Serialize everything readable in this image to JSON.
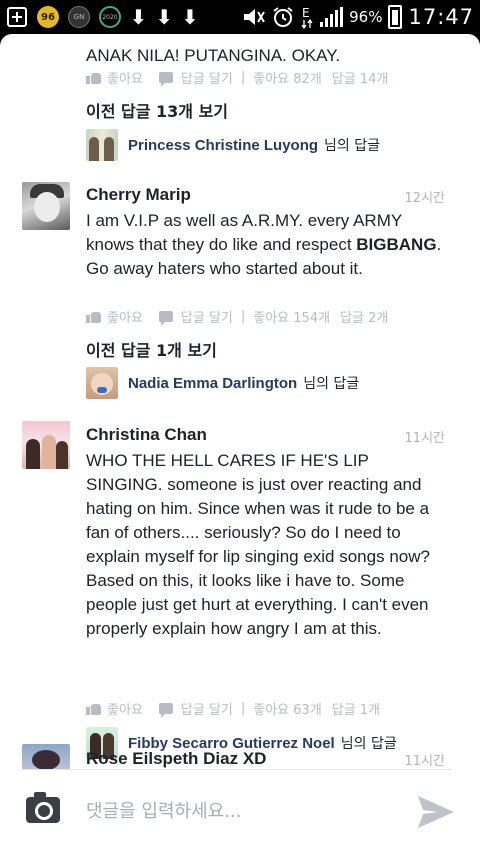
{
  "status_bar": {
    "badge1": "96",
    "badge2": "GN",
    "badge3": "2020",
    "download_glyph": "⬇",
    "battery": "96%",
    "clock": "17:47",
    "icons": [
      "plus-box-icon",
      "sticker-icon",
      "gn-app-icon",
      "ring-app-icon",
      "download-icon",
      "download-icon",
      "download-icon",
      "mute-icon",
      "alarm-icon",
      "data-e-icon",
      "signal-icon",
      "battery-icon"
    ]
  },
  "labels": {
    "like": "좋아요",
    "reply": "답글 달기",
    "separator": "|",
    "reply_suffix": "님의 답글"
  },
  "top_comment": {
    "text": "ANAK NILA! PUTANGINA. OKAY.",
    "likes": "좋아요 82개",
    "replies": "답글 14개",
    "view_previous": "이전 답글 13개 보기",
    "reply_name": "Princess Christine Luyong"
  },
  "comments": [
    {
      "name": "Cherry Marip",
      "time": "12시간",
      "text_before": "I am V.I.P as well as A.R.MY. every ARMY knows that they do like and respect ",
      "text_bold": "BIGBANG",
      "text_after": ". Go away haters who started about it.",
      "likes": "좋아요 154개",
      "replies": "답글 2개",
      "view_previous": "이전 답글 1개 보기",
      "reply_name": "Nadia Emma Darlington"
    },
    {
      "name": "Christina Chan",
      "time": "11시간",
      "text": "WHO THE HELL CARES IF HE'S LIP SINGING. someone is just over reacting and hating on him. Since when was it rude to be a fan of others.... seriously? So do I need to explain myself for lip singing exid songs now? Based on this, it looks like i have to. Some  people just get hurt at everything. I can't even properly explain how angry I am at this.",
      "likes": "좋아요 63개",
      "replies": "답글 1개",
      "reply_name": "Fibby Secarro Gutierrez Noel"
    },
    {
      "name": "Rose Eilspeth Diaz XD",
      "time": "11시간"
    }
  ],
  "composer": {
    "placeholder": "댓글을 입력하세요..."
  },
  "colors": {
    "text": "#1d2129",
    "meta": "#b7bcc4",
    "reply_name": "#283a5e",
    "send": "#bec2c9"
  }
}
